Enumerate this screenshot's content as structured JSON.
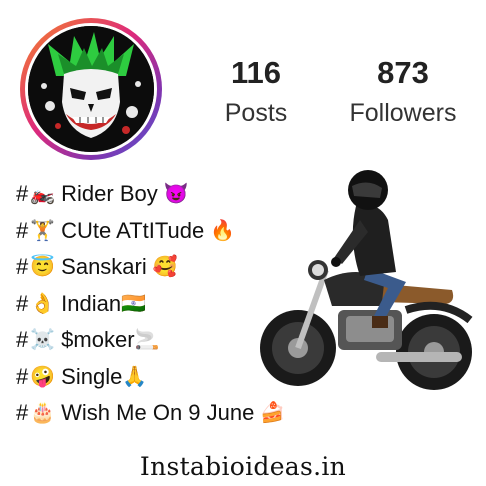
{
  "profile": {
    "avatar_icon": "joker-face-icon",
    "stats": [
      {
        "value": "116",
        "label": "Posts"
      },
      {
        "value": "873",
        "label": "Followers"
      }
    ]
  },
  "bio": [
    {
      "text": "Rider Boy",
      "icon_before": "motorcycle-icon",
      "emoji_before": "🏍️",
      "emoji_after": "😈"
    },
    {
      "text": "CUte ATtITude",
      "icon_before": "weightlifter-icon",
      "emoji_before": "🏋️",
      "emoji_after": "🔥"
    },
    {
      "text": "Sanskari",
      "icon_before": "smiling-halo-icon",
      "emoji_before": "😇",
      "emoji_after": "🥰"
    },
    {
      "text": "Indian",
      "icon_before": "ok-hand-icon",
      "emoji_before": "👌",
      "emoji_after": "🇮🇳"
    },
    {
      "text": "$moker",
      "icon_before": "skull-crossbones-icon",
      "emoji_before": "☠️",
      "emoji_after": "🚬"
    },
    {
      "text": "Single",
      "icon_before": "zany-face-icon",
      "emoji_before": "🤪",
      "emoji_after": "🙏"
    },
    {
      "text": "Wish Me On 9 June",
      "icon_before": "birthday-cake-icon",
      "emoji_before": "🎂",
      "emoji_after": "🍰"
    }
  ],
  "hash_symbol": "#",
  "footer": "Instabioideas.in"
}
